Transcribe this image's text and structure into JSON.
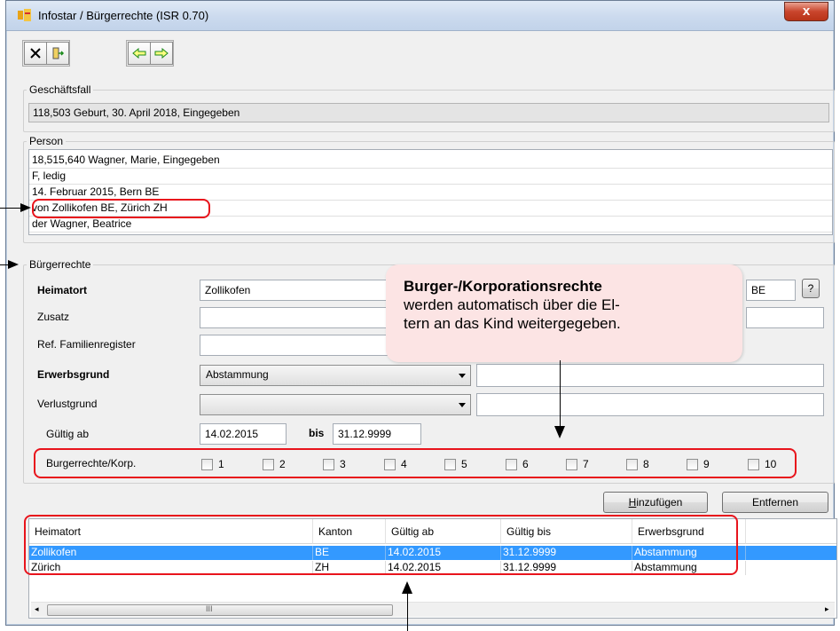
{
  "window": {
    "title": "Infostar / Bürgerrechte (ISR 0.70)",
    "close_label": "x"
  },
  "toolbar": {
    "icons": [
      "close-x-icon",
      "door-exit-icon",
      "arrow-left-icon",
      "arrow-right-icon"
    ]
  },
  "geschaeftsfall": {
    "label": "Geschäftsfall",
    "value": "118,503  Geburt, 30. April 2018, Eingegeben"
  },
  "person": {
    "label": "Person",
    "rows": [
      "18,515,640  Wagner, Marie, Eingegeben",
      "F, ledig",
      "14. Februar 2015, Bern BE",
      "von Zollikofen BE, Zürich ZH",
      "der Wagner, Beatrice"
    ]
  },
  "buergerrechte": {
    "label": "Bürgerrechte",
    "heimatort_label": "Heimatort",
    "heimatort_value": "Zollikofen",
    "kanton_value": "BE",
    "help_label": "?",
    "zusatz_label": "Zusatz",
    "ref_label": "Ref. Familienregister",
    "erwerbsgrund_label": "Erwerbsgrund",
    "erwerbsgrund_value": "Abstammung",
    "verlustgrund_label": "Verlustgrund",
    "gueltig_ab_label": "Gültig ab",
    "gueltig_ab_value": "14.02.2015",
    "bis_label": "bis",
    "bis_value": "31.12.9999",
    "korp_label": "Burgerrechte/Korp.",
    "checkboxes": [
      "1",
      "2",
      "3",
      "4",
      "5",
      "6",
      "7",
      "8",
      "9",
      "10"
    ]
  },
  "buttons": {
    "add_prefix": "H",
    "add_rest": "inzufügen",
    "remove": "Entfernen"
  },
  "grid": {
    "columns": [
      "Heimatort",
      "Kanton",
      "Gültig ab",
      "Gültig bis",
      "Erwerbsgrund"
    ],
    "rows": [
      [
        "Zollikofen",
        "BE",
        "14.02.2015",
        "31.12.9999",
        "Abstammung"
      ],
      [
        "Zürich",
        "ZH",
        "14.02.2015",
        "31.12.9999",
        "Abstammung"
      ]
    ],
    "scroll_thumb_label": "III"
  },
  "callout": {
    "title": "Burger-/Korporationsrechte",
    "line1": "werden automatisch über die El-",
    "line2": "tern an das Kind weitergegeben."
  },
  "colors": {
    "selection": "#3399ff",
    "annotation_red": "#e8141c",
    "callout_bg": "#fce4e4"
  }
}
